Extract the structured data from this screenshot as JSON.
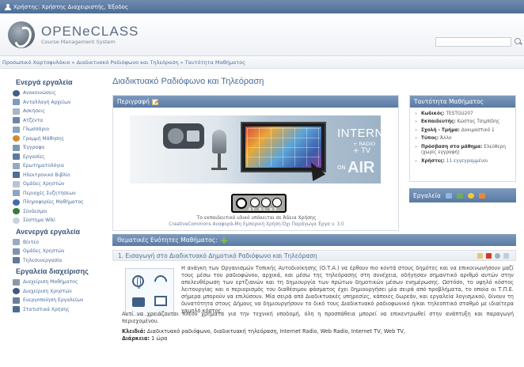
{
  "topbar": {
    "text": "Χρήστης: Χρήστης Διαχειριστής, Έξοδος"
  },
  "header": {
    "logo_title": "OPENeCLASS",
    "logo_subtitle": "Course Management System"
  },
  "breadcrumb": "Προσωπικό Χαρτοφυλάκιο » Διαδικτυακό Ραδιόφωνο και Τηλεόραση » Ταυτότητα Μαθήματος",
  "sidebar": {
    "active_heading": "Ενεργά εργαλεία",
    "active_items": [
      "Ανακοινώσεις",
      "Ανταλλαγή Αρχείων",
      "Ασκήσεις",
      "Ατζέντα",
      "Γλωσσάριο",
      "Γραμμή Μάθησης",
      "Έγγραφα",
      "Εργασίες",
      "Ερωτηματολόγια",
      "Ηλεκτρονικό Βιβλίο",
      "Ομάδες Χρηστών",
      "Περιοχές Συζητήσεων",
      "Πληροφορίες Μαθήματος",
      "Σύνδεσμοι",
      "Σύστημα Wiki"
    ],
    "inactive_heading": "Ανενεργά εργαλεία",
    "inactive_items": [
      "Βίντεο",
      "Ομάδες Χρηστών",
      "Τηλεσυνεργασία"
    ],
    "admin_heading": "Εργαλεία διαχείρισης",
    "admin_items": [
      "Διαχείριση Μαθήματος",
      "Διαχείριση Χρηστών",
      "Ενεργοποίηση Εργαλείων",
      "Στατιστικά Χρήσης"
    ]
  },
  "main": {
    "title": "Διαδικτυακό Ραδιόφωνο και Τηλεόραση",
    "description_label": "Περιγραφή",
    "banner": {
      "internet": "INTERNET",
      "radio": "+ RADIO",
      "tv": "+ TV",
      "on": "ON",
      "air": "AIR"
    },
    "cc": {
      "labels": "BY NC ND"
    },
    "license_text": "Το εκπαιδευτικό υλικό υπόκειται σε Άδεια Χρήσης",
    "license_line2": "CreativeCommons  Αναφορά-Μη Εμπορική Χρήση-Όχι Παράγωγα Έργα v. 3.0"
  },
  "info": {
    "heading": "Ταυτότητα Μαθήματος",
    "rows": [
      {
        "label": "Κωδικός:",
        "value": "TESTGU207"
      },
      {
        "label": "Εκπαιδευτής:",
        "value": "Κώστας Τσιμπίδης"
      },
      {
        "label": "Σχολή - Τμήμα:",
        "value": "Δοκιμαστικό 1"
      },
      {
        "label": "Τύπος:",
        "value": "Άλλο"
      },
      {
        "label": "Πρόσβαση στο μάθημα:",
        "value": "Ελεύθερη (χωρίς εγγραφή)"
      },
      {
        "label": "Χρήστες:",
        "value": "11 εγγεγραμμένοι"
      }
    ],
    "tools_label": "Εργαλεία"
  },
  "units": {
    "heading": "Θεματικές Ενότητες Μαθήματος:",
    "unit_title": "1. Εισαγωγή στο Διαδικτυακό Δημοτικό Ραδιόφωνο και Τηλεόραση",
    "text1": "Η ανάγκη των Οργανισμών Τοπικής Αυτοδιοίκησης (Ο.Τ.Α.) να έρθουν πιο κοντά στους δημότες και να επικοινωνήσουν μαζί τους μέσω του ραδιοφώνου, αρχικά, και μέσω της τηλεόρασης στη συνέχεια, οδήγησαν σημαντικό αριθμό αυτών στην απελευθέρωση των ερτζιανών και τη δημιουργία των πρώτων δημοτικών μέσων ενημέρωσης. Ωστόσο, το υψηλό κόστος λειτουργίας και ο περιορισμός του διαθέσιμου φάσματος έχει δημιουργήσει μία σειρά από προβλήματα, το οποία οι Τ.Π.Ε. σήμερα μπορούν να επιλύσουν. Μία σειρά από Διαδικτυακές υπηρεσίες, κάποιες δωρεάν, και εργαλεία λογισμικού, δίνουν τη δυνατότητα στους Δήμους να δημιουργήσουν το δικό τους Διαδικτυακό ραδιοφωνικό ή/και τηλεοπτικό σταθμό με ιδιαίτερα χαμηλό κόστος.",
    "text2": "Αντί να χρειάζονται πλέον χρήματα για την τεχνική υποδομή, όλη η προσπάθεια μπορεί να επικεντρωθεί στην ανάπτυξη και παραγωγή περιεχομένου.",
    "keywords_label": "Κλειδιά:",
    "keywords": "Διαδικτυακό ραδιόφωνο, διαδικτυακή τηλεόραση, Internet Radio, Web Radio, Internet TV, Web TV,",
    "duration_label": "Διάρκεια:",
    "duration": "1 ώρα"
  },
  "colors": {
    "panel_header": "#5a7aa3",
    "link": "#4a6d99",
    "topbar": "#4d6d96"
  }
}
